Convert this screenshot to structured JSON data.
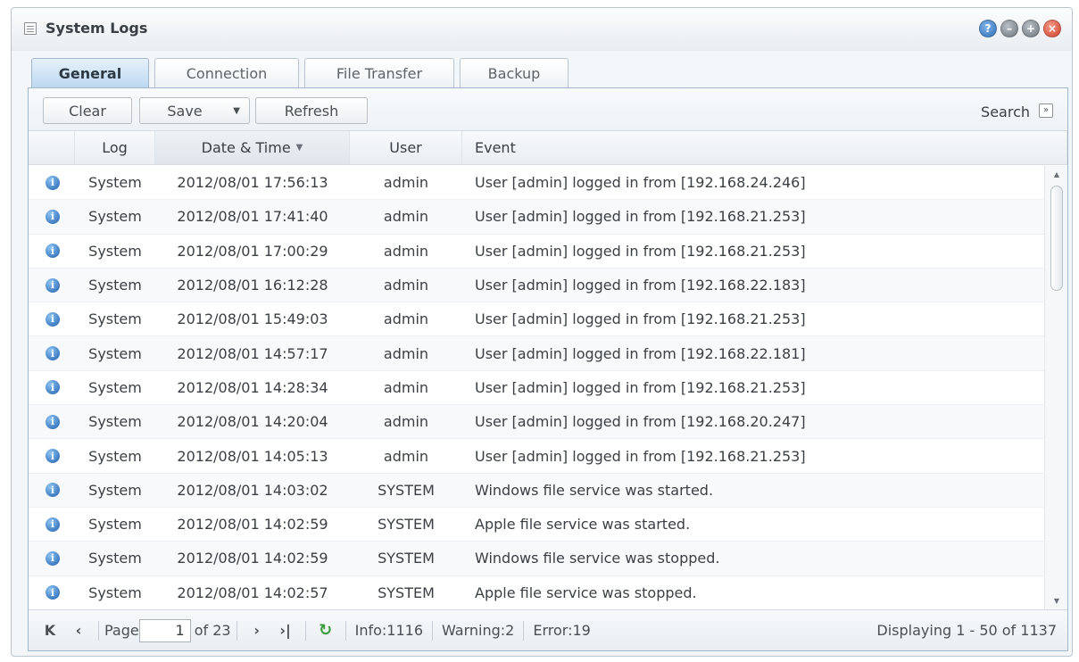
{
  "window": {
    "title": "System Logs",
    "buttons": {
      "help": "?",
      "minimize": "–",
      "maximize": "+",
      "close": "×"
    }
  },
  "tabs": [
    {
      "label": "General",
      "active": true
    },
    {
      "label": "Connection",
      "active": false
    },
    {
      "label": "File Transfer",
      "active": false
    },
    {
      "label": "Backup",
      "active": false
    }
  ],
  "toolbar": {
    "clear_label": "Clear",
    "save_label": "Save",
    "refresh_label": "Refresh",
    "search_label": "Search"
  },
  "columns": {
    "log": "Log",
    "date": "Date & Time",
    "user": "User",
    "event": "Event"
  },
  "rows": [
    {
      "log": "System",
      "date": "2012/08/01 17:56:13",
      "user": "admin",
      "event": "User [admin] logged in from [192.168.24.246]"
    },
    {
      "log": "System",
      "date": "2012/08/01 17:41:40",
      "user": "admin",
      "event": "User [admin] logged in from [192.168.21.253]"
    },
    {
      "log": "System",
      "date": "2012/08/01 17:00:29",
      "user": "admin",
      "event": "User [admin] logged in from [192.168.21.253]"
    },
    {
      "log": "System",
      "date": "2012/08/01 16:12:28",
      "user": "admin",
      "event": "User [admin] logged in from [192.168.22.183]"
    },
    {
      "log": "System",
      "date": "2012/08/01 15:49:03",
      "user": "admin",
      "event": "User [admin] logged in from [192.168.21.253]"
    },
    {
      "log": "System",
      "date": "2012/08/01 14:57:17",
      "user": "admin",
      "event": "User [admin] logged in from [192.168.22.181]"
    },
    {
      "log": "System",
      "date": "2012/08/01 14:28:34",
      "user": "admin",
      "event": "User [admin] logged in from [192.168.21.253]"
    },
    {
      "log": "System",
      "date": "2012/08/01 14:20:04",
      "user": "admin",
      "event": "User [admin] logged in from [192.168.20.247]"
    },
    {
      "log": "System",
      "date": "2012/08/01 14:05:13",
      "user": "admin",
      "event": "User [admin] logged in from [192.168.21.253]"
    },
    {
      "log": "System",
      "date": "2012/08/01 14:03:02",
      "user": "SYSTEM",
      "event": "Windows file service was started."
    },
    {
      "log": "System",
      "date": "2012/08/01 14:02:59",
      "user": "SYSTEM",
      "event": "Apple file service was started."
    },
    {
      "log": "System",
      "date": "2012/08/01 14:02:59",
      "user": "SYSTEM",
      "event": "Windows file service was stopped."
    },
    {
      "log": "System",
      "date": "2012/08/01 14:02:57",
      "user": "SYSTEM",
      "event": "Apple file service was stopped."
    }
  ],
  "pager": {
    "page_label": "Page",
    "page_value": "1",
    "of_label": "of 23",
    "info": "Info:1116",
    "warning": "Warning:2",
    "error": "Error:19",
    "displaying": "Displaying 1 - 50 of 1137"
  },
  "icons": {
    "row_icon": "info-icon",
    "first": "first-page-icon",
    "prev": "prev-page-icon",
    "next": "next-page-icon",
    "last": "last-page-icon",
    "refresh": "refresh-icon"
  },
  "colors": {
    "accent": "#2f6fb6",
    "tab_active": "#bcd7ef",
    "close": "#d0402a"
  }
}
